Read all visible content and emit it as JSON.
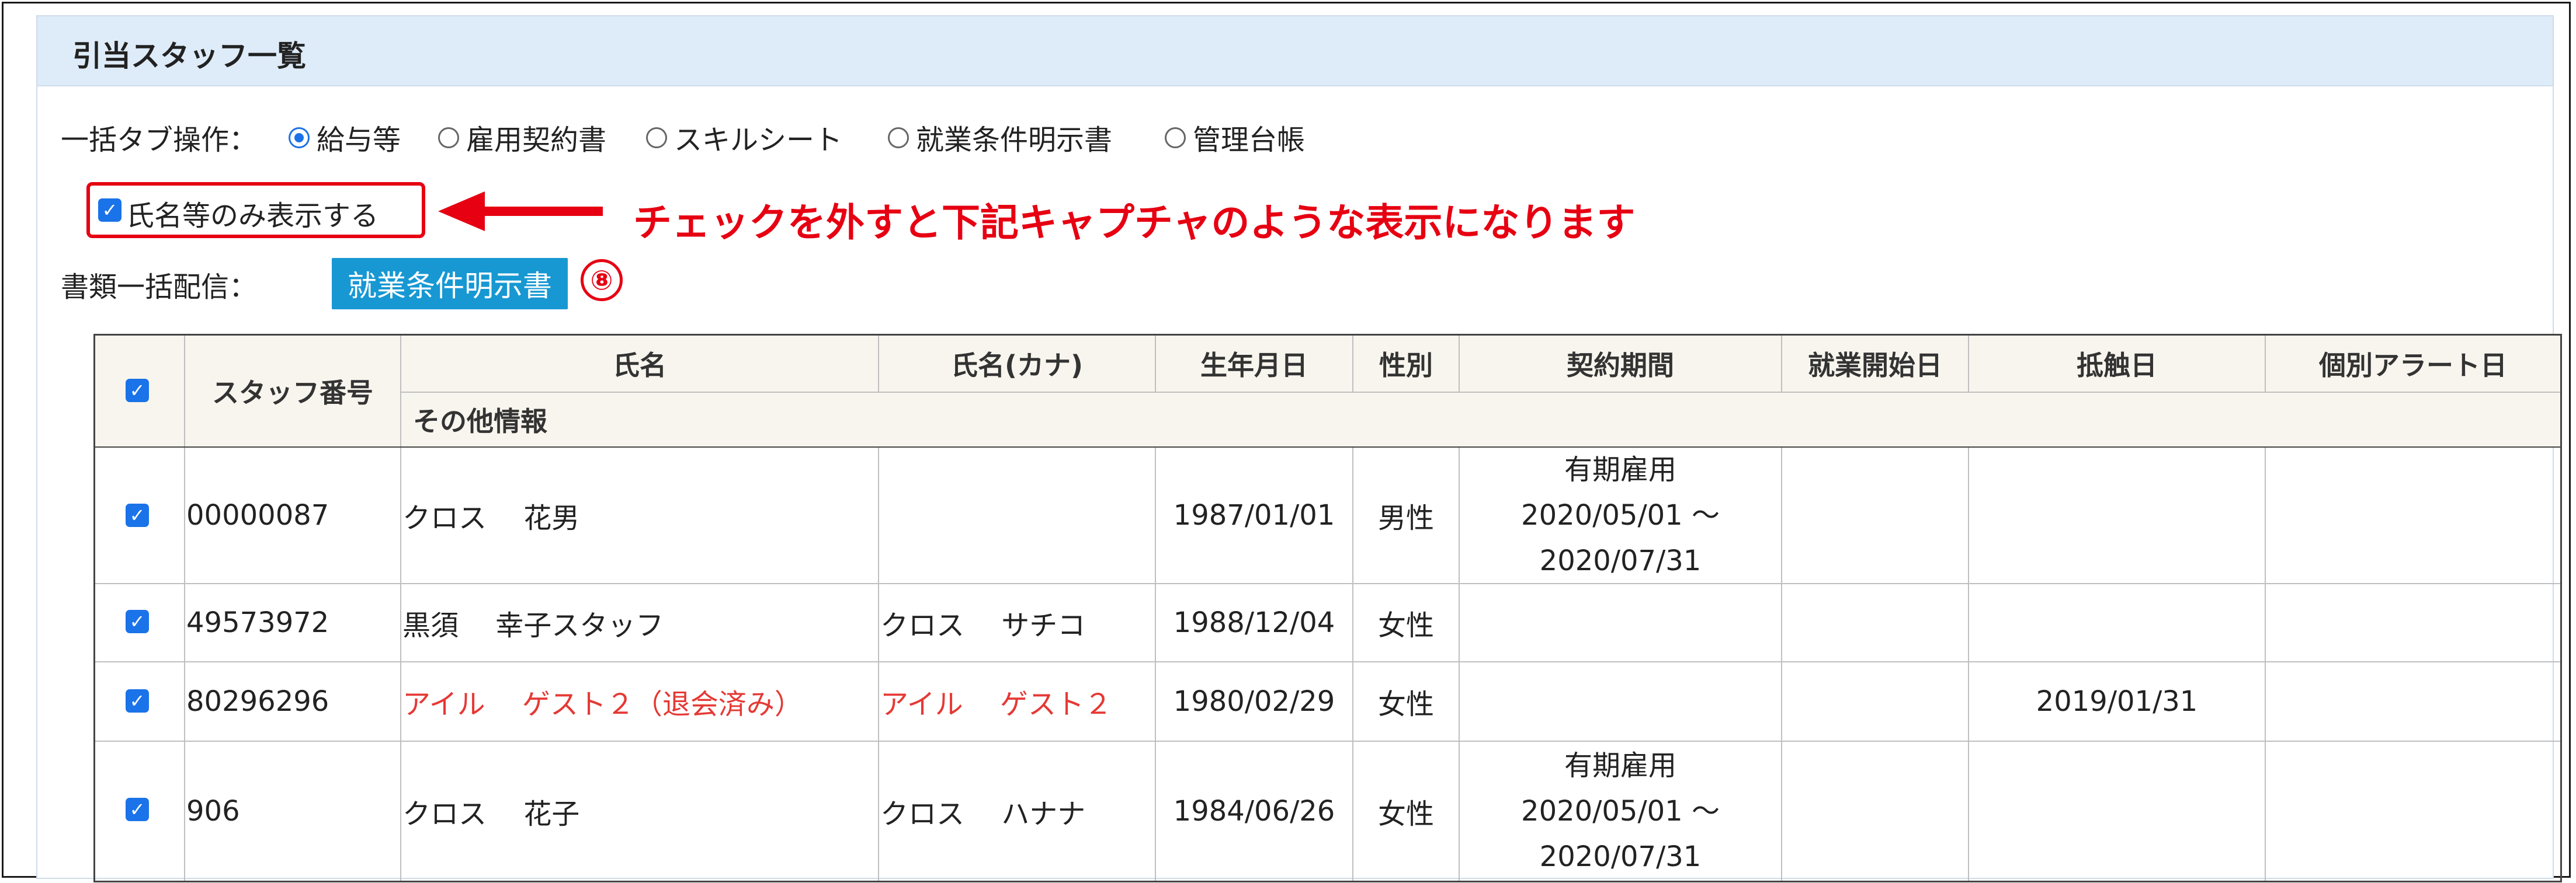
{
  "panel": {
    "title": "引当スタッフ一覧"
  },
  "tab_operation": {
    "label": "一括タブ操作：",
    "options": [
      {
        "label": "給与等",
        "selected": true
      },
      {
        "label": "雇用契約書",
        "selected": false
      },
      {
        "label": "スキルシート",
        "selected": false
      },
      {
        "label": "就業条件明示書",
        "selected": false
      },
      {
        "label": "管理台帳",
        "selected": false
      }
    ]
  },
  "name_only_checkbox": {
    "label": "氏名等のみ表示する",
    "checked": true
  },
  "annotation": {
    "text": "チェックを外すと下記キャプチャのような表示になります",
    "step_number": "⑧",
    "color": "#e60012"
  },
  "bulk_distribution": {
    "label": "書類一括配信：",
    "button": "就業条件明示書",
    "button_color": "#1798d3"
  },
  "table": {
    "headers": [
      "スタッフ番号",
      "氏名",
      "氏名(カナ)",
      "生年月日",
      "性別",
      "契約期間",
      "就業開始日",
      "抵触日",
      "個別アラート日"
    ],
    "subheader": "その他情報",
    "rows": [
      {
        "checked": true,
        "staff_no": "00000087",
        "name": "クロス　 花男",
        "kana": "",
        "birth": "1987/01/01",
        "gender": "男性",
        "contract_type": "有期雇用",
        "contract_start": "2020/05/01 〜",
        "contract_end": "2020/07/31",
        "start_date": "",
        "conflict_date": "",
        "alert_date": "",
        "withdrawn": false
      },
      {
        "checked": true,
        "staff_no": "49573972",
        "name": "黒須　 幸子スタッフ",
        "kana": "クロス　 サチコ",
        "birth": "1988/12/04",
        "gender": "女性",
        "contract_type": "",
        "contract_start": "",
        "contract_end": "",
        "start_date": "",
        "conflict_date": "",
        "alert_date": "",
        "withdrawn": false
      },
      {
        "checked": true,
        "staff_no": "80296296",
        "name": "アイル　 ゲスト２（退会済み）",
        "kana": "アイル　 ゲスト２",
        "birth": "1980/02/29",
        "gender": "女性",
        "contract_type": "",
        "contract_start": "",
        "contract_end": "",
        "start_date": "",
        "conflict_date": "2019/01/31",
        "alert_date": "",
        "withdrawn": true
      },
      {
        "checked": true,
        "staff_no": "906",
        "name": "クロス　 花子",
        "kana": "クロス　 ハナナ",
        "birth": "1984/06/26",
        "gender": "女性",
        "contract_type": "有期雇用",
        "contract_start": "2020/05/01 〜",
        "contract_end": "2020/07/31",
        "start_date": "",
        "conflict_date": "",
        "alert_date": "",
        "withdrawn": false
      }
    ],
    "alert_header_color": "#e53935"
  }
}
